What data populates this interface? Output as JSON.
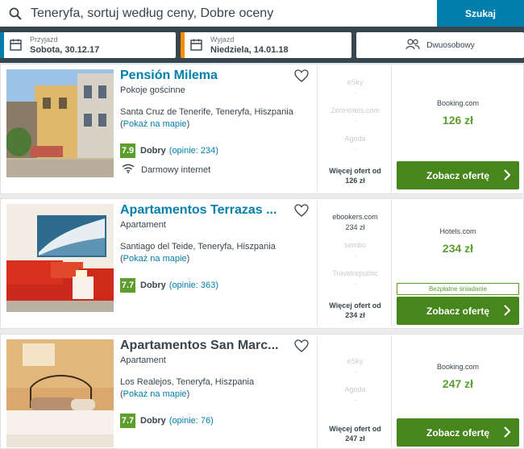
{
  "search": {
    "query": "Teneryfa, sortuj według ceny, Dobre oceny",
    "button_label": "Szukaj"
  },
  "checkin": {
    "label": "Przyjazd",
    "value": "Sobota, 30.12.17",
    "accent_color": "#007fad"
  },
  "checkout": {
    "label": "Wyjazd",
    "value": "Niedziela, 14.01.18",
    "accent_color": "#f48f00"
  },
  "room": {
    "label": "Dwuosobowy",
    "icon": "users-icon"
  },
  "hotels": [
    {
      "name": "Pensión Milema",
      "name_color": "#007fad",
      "type": "Pokoje gościnne",
      "address": "Santa Cruz de Tenerife, Teneryfa, Hiszpania",
      "map_link": "Pokaż na mapie",
      "rating_score": "7.9",
      "rating_text": "Dobry",
      "rating_count": "(opinie: 234)",
      "amenity": "Darmowy internet",
      "other_providers": [
        "eSky",
        "ZenHotels.com",
        "Agoda"
      ],
      "more_offers": "Więcej ofert od",
      "more_offers_price": "126 zł",
      "best_provider": "Booking.com",
      "best_price": "126 zł",
      "deal_label": "Zobacz ofertę"
    },
    {
      "name": "Apartamentos Terrazas ...",
      "name_color": "#007fad",
      "type": "Apartament",
      "address": "Santiago del Teide, Teneryfa, Hiszpania",
      "map_link": "Pokaż na mapie",
      "rating_score": "7.7",
      "rating_text": "Dobry",
      "rating_count": "(opinie: 363)",
      "other_providers": [
        "ebookers.com",
        "sembo",
        "Travelrepublic"
      ],
      "first_provider_price": "234 zł",
      "more_offers": "Więcej ofert od",
      "more_offers_price": "234 zł",
      "best_provider": "Hotels.com",
      "best_price": "234 zł",
      "free_breakfast": "Bezpłatne śniadanie",
      "deal_label": "Zobacz ofertę"
    },
    {
      "name": "Apartamentos San Marc...",
      "name_color": "#37454d",
      "type": "Apartament",
      "address": "Los Realejos, Teneryfa, Hiszpania",
      "map_link": "Pokaż na mapie",
      "rating_score": "7.7",
      "rating_text": "Dobry",
      "rating_count": "(opinie: 76)",
      "other_providers": [
        "eSky",
        "Agoda"
      ],
      "more_offers": "Więcej ofert od",
      "more_offers_price": "247 zł",
      "best_provider": "Booking.com",
      "best_price": "247 zł",
      "deal_label": "Zobacz ofertę"
    }
  ]
}
